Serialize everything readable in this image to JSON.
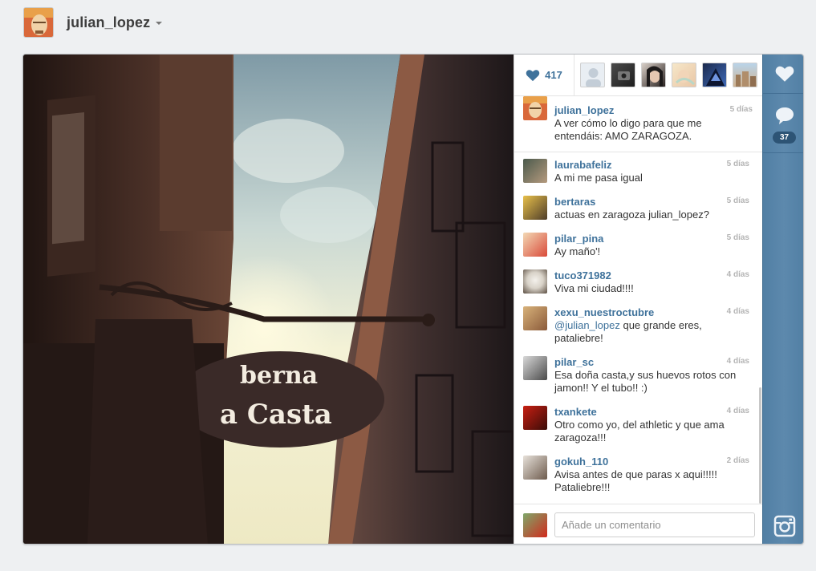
{
  "profile": {
    "username": "julian_lopez"
  },
  "post": {
    "likes": "417",
    "comment_count": "37",
    "sign_text_top": "berna",
    "sign_text_bottom": "a Casta"
  },
  "caption": {
    "username": "julian_lopez",
    "time": "5 días",
    "text": "A ver cómo lo digo para que me entendáis: AMO ZARAGOZA."
  },
  "comments": [
    {
      "username": "laurabafeliz",
      "time": "5 días",
      "text": "A mi me pasa igual"
    },
    {
      "username": "bertaras",
      "time": "5 días",
      "text": "actuas en zaragoza julian_lopez?"
    },
    {
      "username": "pilar_pina",
      "time": "5 días",
      "text": "Ay maño'!"
    },
    {
      "username": "tuco371982",
      "time": "4 días",
      "text": "Viva mi ciudad!!!!"
    },
    {
      "username": "xexu_nuestroctubre",
      "time": "4 días",
      "mention": "@julian_lopez",
      "text": " que grande eres, pataliebre!"
    },
    {
      "username": "pilar_sc",
      "time": "4 días",
      "text": "Esa doña casta,y sus huevos rotos con jamon!! Y el tubo!! :)"
    },
    {
      "username": "txankete",
      "time": "4 días",
      "text": "Otro como yo, del athletic y que ama zaragoza!!!"
    },
    {
      "username": "gokuh_110",
      "time": "2 días",
      "text": "Avisa antes de que paras x aqui!!!!! Pataliebre!!!"
    }
  ],
  "comment_form": {
    "placeholder": "Añade un comentario"
  },
  "colors": {
    "link": "#3f729b",
    "rail": "#517fa4",
    "time": "#b4b4b4"
  }
}
